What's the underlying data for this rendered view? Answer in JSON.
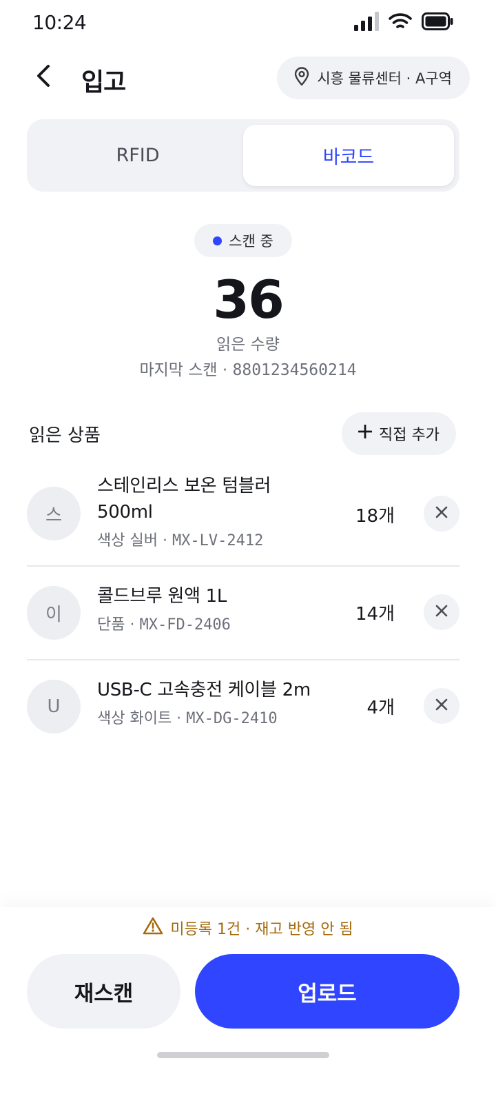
{
  "status_bar": {
    "time": "10:24",
    "icons": [
      "signal-icon",
      "wifi-icon",
      "battery-icon"
    ]
  },
  "header": {
    "title": "입고",
    "location": "시흥 물류센터 · A구역"
  },
  "tabs": [
    {
      "label": "RFID",
      "active": false
    },
    {
      "label": "바코드",
      "active": true
    }
  ],
  "scan": {
    "status": "스캔 중",
    "count": "36",
    "count_label": "읽은 수량",
    "last_scan_label": "마지막 스캔 · ",
    "last_scan_code": "8801234560214"
  },
  "list": {
    "title": "읽은 상품",
    "add_label": "직접 추가",
    "items": [
      {
        "initial": "스",
        "name": "스테인리스 보온 텀블러 500ml",
        "option": "색상 실버 · ",
        "sku": "MX-LV-2412",
        "qty": "18개"
      },
      {
        "initial": "이",
        "name": "콜드브루 원액 1L",
        "option": "단품 · ",
        "sku": "MX-FD-2406",
        "qty": "14개"
      },
      {
        "initial": "U",
        "name": "USB-C 고속충전 케이블 2m",
        "option": "색상 화이트 · ",
        "sku": "MX-DG-2410",
        "qty": "4개"
      }
    ]
  },
  "footer": {
    "warning": "미등록 1건 · 재고 반영 안 됨",
    "rescan_label": "재스캔",
    "upload_label": "업로드"
  },
  "colors": {
    "accent": "#2f45ff",
    "warning": "#a46a0b",
    "surface": "#f1f2f5"
  }
}
